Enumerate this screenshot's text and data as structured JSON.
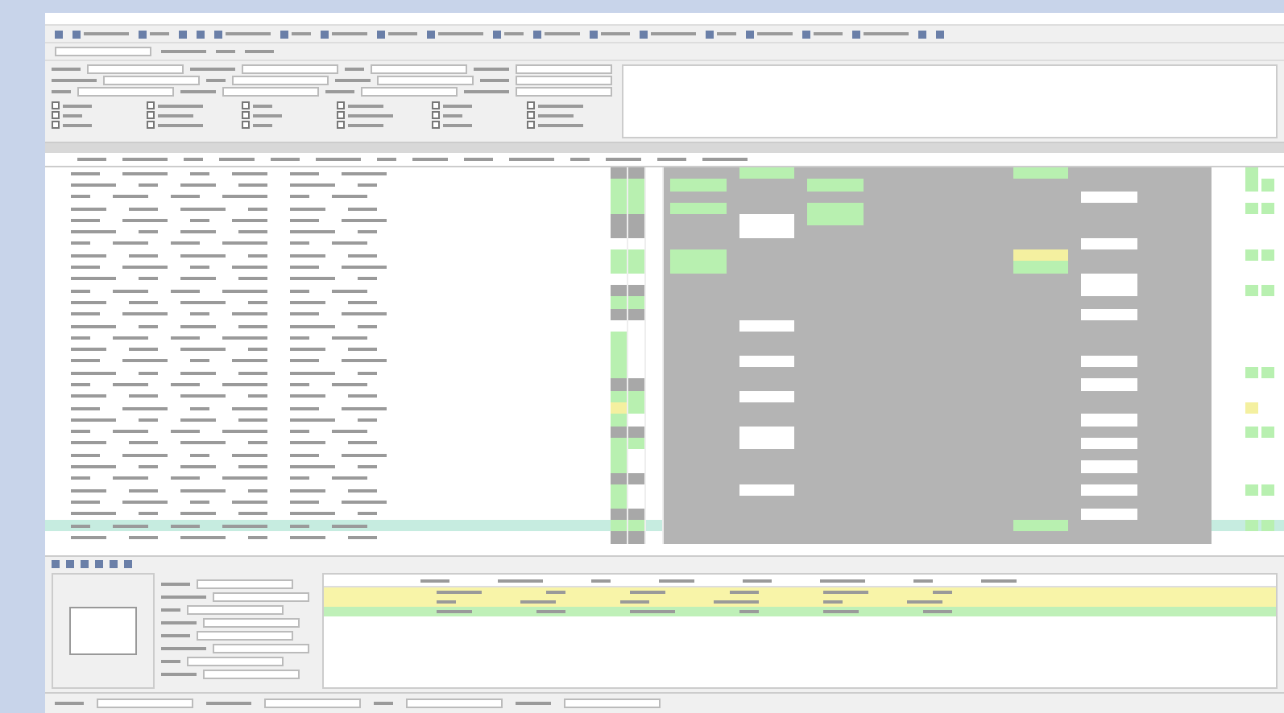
{
  "toolbar": {
    "items": [
      {
        "kind": "icon"
      },
      {
        "kind": "text"
      },
      {
        "kind": "text"
      },
      {
        "kind": "icon"
      },
      {
        "kind": "icon"
      },
      {
        "kind": "text"
      },
      {
        "kind": "text"
      },
      {
        "kind": "text"
      },
      {
        "kind": "text"
      },
      {
        "kind": "text"
      },
      {
        "kind": "text"
      },
      {
        "kind": "text"
      },
      {
        "kind": "text"
      },
      {
        "kind": "text"
      },
      {
        "kind": "text"
      },
      {
        "kind": "text"
      },
      {
        "kind": "text"
      },
      {
        "kind": "text"
      },
      {
        "kind": "icon"
      },
      {
        "kind": "icon"
      }
    ]
  },
  "filters": {
    "checkboxes": [
      {
        "checked": false
      },
      {
        "checked": false
      },
      {
        "checked": false
      },
      {
        "checked": false
      },
      {
        "checked": false
      },
      {
        "checked": false
      },
      {
        "checked": false
      },
      {
        "checked": false
      },
      {
        "checked": false
      },
      {
        "checked": false
      },
      {
        "checked": false
      },
      {
        "checked": false
      },
      {
        "checked": false
      },
      {
        "checked": false
      },
      {
        "checked": false
      },
      {
        "checked": false
      },
      {
        "checked": false
      },
      {
        "checked": false
      }
    ]
  },
  "grid": {
    "rows": [
      {
        "selected": false,
        "flags": [
          {
            "color": "#a8a8a8"
          },
          {
            "color": "#a8a8a8"
          },
          {
            "kind": "blank"
          }
        ],
        "band": [
          {
            "kind": "blank"
          },
          {
            "color": "#b8f0b0"
          },
          {
            "kind": "blank"
          },
          {
            "kind": "blank"
          },
          {
            "kind": "blank"
          },
          {
            "color": "#b8f0b0"
          },
          {
            "kind": "blank"
          },
          {
            "kind": "blank"
          }
        ],
        "right": [
          {
            "color": "#b8f0b0"
          },
          {
            "kind": "blank"
          }
        ]
      },
      {
        "selected": false,
        "flags": [
          {
            "color": "#b8f0b0"
          },
          {
            "color": "#b8f0b0"
          },
          {
            "kind": "blank"
          }
        ],
        "band": [
          {
            "color": "#b8f0b0"
          },
          {
            "kind": "blank"
          },
          {
            "color": "#b8f0b0"
          },
          {
            "kind": "blank"
          },
          {
            "kind": "blank"
          },
          {
            "kind": "blank"
          },
          {
            "kind": "blank"
          },
          {
            "kind": "blank"
          }
        ],
        "right": [
          {
            "color": "#b8f0b0"
          },
          {
            "color": "#b8f0b0"
          }
        ]
      },
      {
        "selected": false,
        "flags": [
          {
            "color": "#b8f0b0"
          },
          {
            "color": "#b8f0b0"
          },
          {
            "kind": "blank"
          }
        ],
        "band": [
          {
            "kind": "blank"
          },
          {
            "kind": "blank"
          },
          {
            "kind": "blank"
          },
          {
            "kind": "blank"
          },
          {
            "kind": "blank"
          },
          {
            "kind": "blank"
          },
          {
            "color": "#ffffff"
          },
          {
            "kind": "blank"
          }
        ],
        "right": [
          {
            "kind": "blank"
          },
          {
            "kind": "blank"
          }
        ]
      },
      {
        "selected": false,
        "flags": [
          {
            "color": "#b8f0b0"
          },
          {
            "color": "#b8f0b0"
          },
          {
            "kind": "blank"
          }
        ],
        "band": [
          {
            "color": "#b8f0b0"
          },
          {
            "kind": "blank"
          },
          {
            "color": "#b8f0b0"
          },
          {
            "kind": "blank"
          },
          {
            "kind": "blank"
          },
          {
            "kind": "blank"
          },
          {
            "kind": "blank"
          },
          {
            "kind": "blank"
          }
        ],
        "right": [
          {
            "color": "#b8f0b0"
          },
          {
            "color": "#b8f0b0"
          }
        ]
      },
      {
        "selected": false,
        "flags": [
          {
            "color": "#a8a8a8"
          },
          {
            "color": "#a8a8a8"
          },
          {
            "kind": "blank"
          }
        ],
        "band": [
          {
            "kind": "blank"
          },
          {
            "color": "#ffffff"
          },
          {
            "color": "#b8f0b0"
          },
          {
            "kind": "blank"
          },
          {
            "kind": "blank"
          },
          {
            "kind": "blank"
          },
          {
            "kind": "blank"
          },
          {
            "kind": "blank"
          }
        ],
        "right": [
          {
            "kind": "blank"
          },
          {
            "kind": "blank"
          }
        ]
      },
      {
        "selected": false,
        "flags": [
          {
            "color": "#a8a8a8"
          },
          {
            "color": "#a8a8a8"
          },
          {
            "kind": "blank"
          }
        ],
        "band": [
          {
            "kind": "blank"
          },
          {
            "color": "#ffffff"
          },
          {
            "kind": "blank"
          },
          {
            "kind": "blank"
          },
          {
            "kind": "blank"
          },
          {
            "kind": "blank"
          },
          {
            "kind": "blank"
          },
          {
            "kind": "blank"
          }
        ],
        "right": [
          {
            "kind": "blank"
          },
          {
            "kind": "blank"
          }
        ]
      },
      {
        "selected": false,
        "flags": [
          {
            "kind": "blank"
          },
          {
            "kind": "blank"
          },
          {
            "kind": "blank"
          }
        ],
        "band": [
          {
            "kind": "blank"
          },
          {
            "kind": "blank"
          },
          {
            "kind": "blank"
          },
          {
            "kind": "blank"
          },
          {
            "kind": "blank"
          },
          {
            "kind": "blank"
          },
          {
            "color": "#ffffff"
          },
          {
            "kind": "blank"
          }
        ],
        "right": [
          {
            "kind": "blank"
          },
          {
            "kind": "blank"
          }
        ]
      },
      {
        "selected": false,
        "flags": [
          {
            "color": "#b8f0b0"
          },
          {
            "color": "#b8f0b0"
          },
          {
            "kind": "blank"
          }
        ],
        "band": [
          {
            "color": "#b8f0b0"
          },
          {
            "kind": "blank"
          },
          {
            "kind": "blank"
          },
          {
            "kind": "blank"
          },
          {
            "kind": "blank"
          },
          {
            "color": "#f4f0a0"
          },
          {
            "kind": "blank"
          },
          {
            "kind": "blank"
          }
        ],
        "right": [
          {
            "color": "#b8f0b0"
          },
          {
            "color": "#b8f0b0"
          }
        ]
      },
      {
        "selected": false,
        "flags": [
          {
            "color": "#b8f0b0"
          },
          {
            "color": "#b8f0b0"
          },
          {
            "kind": "blank"
          }
        ],
        "band": [
          {
            "color": "#b8f0b0"
          },
          {
            "kind": "blank"
          },
          {
            "kind": "blank"
          },
          {
            "kind": "blank"
          },
          {
            "kind": "blank"
          },
          {
            "color": "#b8f0b0"
          },
          {
            "kind": "blank"
          },
          {
            "kind": "blank"
          }
        ],
        "right": [
          {
            "kind": "blank"
          },
          {
            "kind": "blank"
          }
        ]
      },
      {
        "selected": false,
        "flags": [
          {
            "kind": "blank"
          },
          {
            "kind": "blank"
          },
          {
            "kind": "blank"
          }
        ],
        "band": [
          {
            "kind": "blank"
          },
          {
            "kind": "blank"
          },
          {
            "kind": "blank"
          },
          {
            "kind": "blank"
          },
          {
            "kind": "blank"
          },
          {
            "kind": "blank"
          },
          {
            "color": "#ffffff"
          },
          {
            "kind": "blank"
          }
        ],
        "right": [
          {
            "kind": "blank"
          },
          {
            "kind": "blank"
          }
        ]
      },
      {
        "selected": false,
        "flags": [
          {
            "color": "#a8a8a8"
          },
          {
            "color": "#a8a8a8"
          },
          {
            "kind": "blank"
          }
        ],
        "band": [
          {
            "kind": "blank"
          },
          {
            "kind": "blank"
          },
          {
            "kind": "blank"
          },
          {
            "kind": "blank"
          },
          {
            "kind": "blank"
          },
          {
            "kind": "blank"
          },
          {
            "color": "#ffffff"
          },
          {
            "kind": "blank"
          }
        ],
        "right": [
          {
            "color": "#b8f0b0"
          },
          {
            "color": "#b8f0b0"
          }
        ]
      },
      {
        "selected": false,
        "flags": [
          {
            "color": "#b8f0b0"
          },
          {
            "color": "#b8f0b0"
          },
          {
            "kind": "blank"
          }
        ],
        "band": [
          {
            "kind": "blank"
          },
          {
            "kind": "blank"
          },
          {
            "kind": "blank"
          },
          {
            "kind": "blank"
          },
          {
            "kind": "blank"
          },
          {
            "kind": "blank"
          },
          {
            "kind": "blank"
          },
          {
            "kind": "blank"
          }
        ],
        "right": [
          {
            "kind": "blank"
          },
          {
            "kind": "blank"
          }
        ]
      },
      {
        "selected": false,
        "flags": [
          {
            "color": "#a8a8a8"
          },
          {
            "color": "#a8a8a8"
          },
          {
            "kind": "blank"
          }
        ],
        "band": [
          {
            "kind": "blank"
          },
          {
            "kind": "blank"
          },
          {
            "kind": "blank"
          },
          {
            "kind": "blank"
          },
          {
            "kind": "blank"
          },
          {
            "kind": "blank"
          },
          {
            "color": "#ffffff"
          },
          {
            "kind": "blank"
          }
        ],
        "right": [
          {
            "kind": "blank"
          },
          {
            "kind": "blank"
          }
        ]
      },
      {
        "selected": false,
        "flags": [
          {
            "kind": "blank"
          },
          {
            "kind": "blank"
          },
          {
            "kind": "blank"
          }
        ],
        "band": [
          {
            "kind": "blank"
          },
          {
            "color": "#ffffff"
          },
          {
            "kind": "blank"
          },
          {
            "kind": "blank"
          },
          {
            "kind": "blank"
          },
          {
            "kind": "blank"
          },
          {
            "kind": "blank"
          },
          {
            "kind": "blank"
          }
        ],
        "right": [
          {
            "kind": "blank"
          },
          {
            "kind": "blank"
          }
        ]
      },
      {
        "selected": false,
        "flags": [
          {
            "color": "#b8f0b0"
          },
          {
            "kind": "blank"
          },
          {
            "kind": "blank"
          }
        ],
        "band": [
          {
            "kind": "blank"
          },
          {
            "kind": "blank"
          },
          {
            "kind": "blank"
          },
          {
            "kind": "blank"
          },
          {
            "kind": "blank"
          },
          {
            "kind": "blank"
          },
          {
            "kind": "blank"
          },
          {
            "kind": "blank"
          }
        ],
        "right": [
          {
            "kind": "blank"
          },
          {
            "kind": "blank"
          }
        ]
      },
      {
        "selected": false,
        "flags": [
          {
            "color": "#b8f0b0"
          },
          {
            "kind": "blank"
          },
          {
            "kind": "blank"
          }
        ],
        "band": [
          {
            "kind": "blank"
          },
          {
            "kind": "blank"
          },
          {
            "kind": "blank"
          },
          {
            "kind": "blank"
          },
          {
            "kind": "blank"
          },
          {
            "kind": "blank"
          },
          {
            "kind": "blank"
          },
          {
            "kind": "blank"
          }
        ],
        "right": [
          {
            "kind": "blank"
          },
          {
            "kind": "blank"
          }
        ]
      },
      {
        "selected": false,
        "flags": [
          {
            "color": "#b8f0b0"
          },
          {
            "kind": "blank"
          },
          {
            "kind": "blank"
          }
        ],
        "band": [
          {
            "kind": "blank"
          },
          {
            "color": "#ffffff"
          },
          {
            "kind": "blank"
          },
          {
            "kind": "blank"
          },
          {
            "kind": "blank"
          },
          {
            "kind": "blank"
          },
          {
            "color": "#ffffff"
          },
          {
            "kind": "blank"
          }
        ],
        "right": [
          {
            "kind": "blank"
          },
          {
            "kind": "blank"
          }
        ]
      },
      {
        "selected": false,
        "flags": [
          {
            "color": "#b8f0b0"
          },
          {
            "kind": "blank"
          },
          {
            "kind": "blank"
          }
        ],
        "band": [
          {
            "kind": "blank"
          },
          {
            "kind": "blank"
          },
          {
            "kind": "blank"
          },
          {
            "kind": "blank"
          },
          {
            "kind": "blank"
          },
          {
            "kind": "blank"
          },
          {
            "kind": "blank"
          },
          {
            "kind": "blank"
          }
        ],
        "right": [
          {
            "color": "#b8f0b0"
          },
          {
            "color": "#b8f0b0"
          }
        ]
      },
      {
        "selected": false,
        "flags": [
          {
            "color": "#a8a8a8"
          },
          {
            "color": "#a8a8a8"
          },
          {
            "kind": "blank"
          }
        ],
        "band": [
          {
            "kind": "blank"
          },
          {
            "kind": "blank"
          },
          {
            "kind": "blank"
          },
          {
            "kind": "blank"
          },
          {
            "kind": "blank"
          },
          {
            "kind": "blank"
          },
          {
            "color": "#ffffff"
          },
          {
            "kind": "blank"
          }
        ],
        "right": [
          {
            "kind": "blank"
          },
          {
            "kind": "blank"
          }
        ]
      },
      {
        "selected": false,
        "flags": [
          {
            "color": "#b8f0b0"
          },
          {
            "color": "#b8f0b0"
          },
          {
            "kind": "blank"
          }
        ],
        "band": [
          {
            "kind": "blank"
          },
          {
            "color": "#ffffff"
          },
          {
            "kind": "blank"
          },
          {
            "kind": "blank"
          },
          {
            "kind": "blank"
          },
          {
            "kind": "blank"
          },
          {
            "kind": "blank"
          },
          {
            "kind": "blank"
          }
        ],
        "right": [
          {
            "kind": "blank"
          },
          {
            "kind": "blank"
          }
        ]
      },
      {
        "selected": false,
        "flags": [
          {
            "color": "#f4f0a0"
          },
          {
            "color": "#b8f0b0"
          },
          {
            "kind": "blank"
          }
        ],
        "band": [
          {
            "kind": "blank"
          },
          {
            "kind": "blank"
          },
          {
            "kind": "blank"
          },
          {
            "kind": "blank"
          },
          {
            "kind": "blank"
          },
          {
            "kind": "blank"
          },
          {
            "kind": "blank"
          },
          {
            "kind": "blank"
          }
        ],
        "right": [
          {
            "color": "#f4f0a0"
          },
          {
            "kind": "blank"
          }
        ]
      },
      {
        "selected": false,
        "flags": [
          {
            "color": "#b8f0b0"
          },
          {
            "kind": "blank"
          },
          {
            "kind": "blank"
          }
        ],
        "band": [
          {
            "kind": "blank"
          },
          {
            "kind": "blank"
          },
          {
            "kind": "blank"
          },
          {
            "kind": "blank"
          },
          {
            "kind": "blank"
          },
          {
            "kind": "blank"
          },
          {
            "color": "#ffffff"
          },
          {
            "kind": "blank"
          }
        ],
        "right": [
          {
            "kind": "blank"
          },
          {
            "kind": "blank"
          }
        ]
      },
      {
        "selected": false,
        "flags": [
          {
            "color": "#a8a8a8"
          },
          {
            "color": "#a8a8a8"
          },
          {
            "kind": "blank"
          }
        ],
        "band": [
          {
            "kind": "blank"
          },
          {
            "color": "#ffffff"
          },
          {
            "kind": "blank"
          },
          {
            "kind": "blank"
          },
          {
            "kind": "blank"
          },
          {
            "kind": "blank"
          },
          {
            "kind": "blank"
          },
          {
            "kind": "blank"
          }
        ],
        "right": [
          {
            "color": "#b8f0b0"
          },
          {
            "color": "#b8f0b0"
          }
        ]
      },
      {
        "selected": false,
        "flags": [
          {
            "color": "#b8f0b0"
          },
          {
            "color": "#b8f0b0"
          },
          {
            "kind": "blank"
          }
        ],
        "band": [
          {
            "kind": "blank"
          },
          {
            "color": "#ffffff"
          },
          {
            "kind": "blank"
          },
          {
            "kind": "blank"
          },
          {
            "kind": "blank"
          },
          {
            "kind": "blank"
          },
          {
            "color": "#ffffff"
          },
          {
            "kind": "blank"
          }
        ],
        "right": [
          {
            "kind": "blank"
          },
          {
            "kind": "blank"
          }
        ]
      },
      {
        "selected": false,
        "flags": [
          {
            "color": "#b8f0b0"
          },
          {
            "kind": "blank"
          },
          {
            "kind": "blank"
          }
        ],
        "band": [
          {
            "kind": "blank"
          },
          {
            "kind": "blank"
          },
          {
            "kind": "blank"
          },
          {
            "kind": "blank"
          },
          {
            "kind": "blank"
          },
          {
            "kind": "blank"
          },
          {
            "kind": "blank"
          },
          {
            "kind": "blank"
          }
        ],
        "right": [
          {
            "kind": "blank"
          },
          {
            "kind": "blank"
          }
        ]
      },
      {
        "selected": false,
        "flags": [
          {
            "color": "#b8f0b0"
          },
          {
            "kind": "blank"
          },
          {
            "kind": "blank"
          }
        ],
        "band": [
          {
            "kind": "blank"
          },
          {
            "kind": "blank"
          },
          {
            "kind": "blank"
          },
          {
            "kind": "blank"
          },
          {
            "kind": "blank"
          },
          {
            "kind": "blank"
          },
          {
            "color": "#ffffff"
          },
          {
            "kind": "blank"
          }
        ],
        "right": [
          {
            "kind": "blank"
          },
          {
            "kind": "blank"
          }
        ]
      },
      {
        "selected": false,
        "flags": [
          {
            "color": "#a8a8a8"
          },
          {
            "color": "#a8a8a8"
          },
          {
            "kind": "blank"
          }
        ],
        "band": [
          {
            "kind": "blank"
          },
          {
            "kind": "blank"
          },
          {
            "kind": "blank"
          },
          {
            "kind": "blank"
          },
          {
            "kind": "blank"
          },
          {
            "kind": "blank"
          },
          {
            "kind": "blank"
          },
          {
            "kind": "blank"
          }
        ],
        "right": [
          {
            "kind": "blank"
          },
          {
            "kind": "blank"
          }
        ]
      },
      {
        "selected": false,
        "flags": [
          {
            "color": "#b8f0b0"
          },
          {
            "kind": "blank"
          },
          {
            "kind": "blank"
          }
        ],
        "band": [
          {
            "kind": "blank"
          },
          {
            "color": "#ffffff"
          },
          {
            "kind": "blank"
          },
          {
            "kind": "blank"
          },
          {
            "kind": "blank"
          },
          {
            "kind": "blank"
          },
          {
            "color": "#ffffff"
          },
          {
            "kind": "blank"
          }
        ],
        "right": [
          {
            "color": "#b8f0b0"
          },
          {
            "color": "#b8f0b0"
          }
        ]
      },
      {
        "selected": false,
        "flags": [
          {
            "color": "#b8f0b0"
          },
          {
            "kind": "blank"
          },
          {
            "kind": "blank"
          }
        ],
        "band": [
          {
            "kind": "blank"
          },
          {
            "kind": "blank"
          },
          {
            "kind": "blank"
          },
          {
            "kind": "blank"
          },
          {
            "kind": "blank"
          },
          {
            "kind": "blank"
          },
          {
            "kind": "blank"
          },
          {
            "kind": "blank"
          }
        ],
        "right": [
          {
            "kind": "blank"
          },
          {
            "kind": "blank"
          }
        ]
      },
      {
        "selected": false,
        "flags": [
          {
            "color": "#a8a8a8"
          },
          {
            "color": "#a8a8a8"
          },
          {
            "kind": "blank"
          }
        ],
        "band": [
          {
            "kind": "blank"
          },
          {
            "kind": "blank"
          },
          {
            "kind": "blank"
          },
          {
            "kind": "blank"
          },
          {
            "kind": "blank"
          },
          {
            "kind": "blank"
          },
          {
            "color": "#ffffff"
          },
          {
            "kind": "blank"
          }
        ],
        "right": [
          {
            "kind": "blank"
          },
          {
            "kind": "blank"
          }
        ]
      },
      {
        "selected": true,
        "flags": [
          {
            "color": "#b8f0b0"
          },
          {
            "color": "#b8f0b0"
          },
          {
            "kind": "blank"
          }
        ],
        "band": [
          {
            "kind": "blank"
          },
          {
            "kind": "blank"
          },
          {
            "kind": "blank"
          },
          {
            "kind": "blank"
          },
          {
            "kind": "blank"
          },
          {
            "color": "#b8f0b0"
          },
          {
            "kind": "blank"
          },
          {
            "kind": "blank"
          }
        ],
        "right": [
          {
            "color": "#b8f0b0"
          },
          {
            "color": "#b8f0b0"
          }
        ]
      },
      {
        "selected": false,
        "flags": [
          {
            "color": "#a8a8a8"
          },
          {
            "color": "#a8a8a8"
          },
          {
            "kind": "blank"
          }
        ],
        "band": [
          {
            "kind": "blank"
          },
          {
            "kind": "blank"
          },
          {
            "kind": "blank"
          },
          {
            "kind": "blank"
          },
          {
            "kind": "blank"
          },
          {
            "kind": "blank"
          },
          {
            "kind": "blank"
          },
          {
            "kind": "blank"
          }
        ],
        "right": [
          {
            "kind": "blank"
          },
          {
            "kind": "blank"
          }
        ]
      }
    ]
  },
  "detail_table": {
    "rows": [
      {
        "color": "#f8f4a8"
      },
      {
        "color": "#f8f4a8"
      },
      {
        "color": "#bff0b8"
      }
    ]
  }
}
